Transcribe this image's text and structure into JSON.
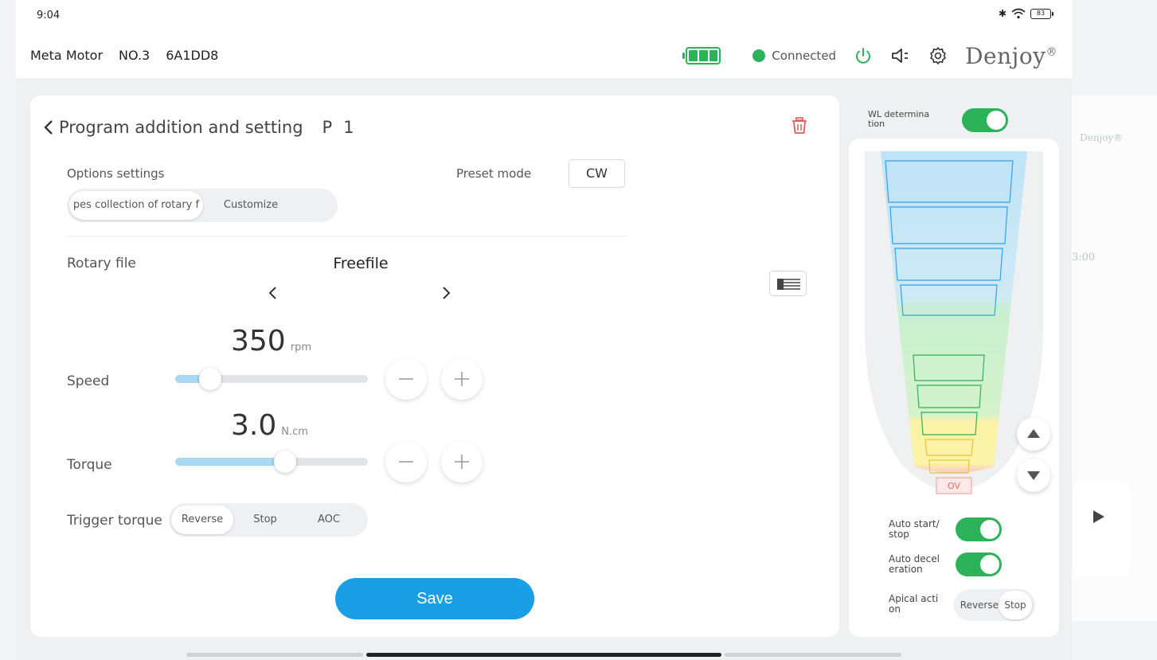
{
  "status_bar": {
    "time": "9:04",
    "battery": "83"
  },
  "app_bar": {
    "device_name": "Meta Motor",
    "device_no": "NO.3",
    "device_id": "6A1DD8",
    "connection_status": "Connected",
    "brand": "Denjoy",
    "brand_mark": "®"
  },
  "program": {
    "title": "Program addition and setting",
    "program_label": "P",
    "program_number": "1",
    "options_label": "Options settings",
    "option_tabs": [
      "pes collection of rotary f",
      "Customize"
    ],
    "preset_label": "Preset mode",
    "preset_value": "CW",
    "rotary_file_label": "Rotary file",
    "rotary_file_value": "Freefile",
    "speed": {
      "label": "Speed",
      "value": "350",
      "unit": "rpm",
      "level": 0.18
    },
    "torque": {
      "label": "Torque",
      "value": "3.0",
      "unit": "N.cm",
      "level": 0.57
    },
    "trigger_label": "Trigger torque",
    "trigger_options": [
      "Reverse",
      "Stop",
      "AOC"
    ],
    "save_label": "Save"
  },
  "right_panel": {
    "wl_label": "WL determina tion",
    "ov_label": "OV",
    "auto_start_label": "Auto start/ stop",
    "auto_decel_label": "Auto decel eration",
    "apical_label": "Apical acti on",
    "apical_options": [
      "Reverse",
      "Stop"
    ]
  },
  "background_app": {
    "brand": "Denjoy®",
    "time_fragment": "3:00"
  },
  "colors": {
    "accent": "#1a9ee6",
    "connected": "#2cb35a",
    "toggle_on": "#2cb35a",
    "slider_fill": "#a9d8f3",
    "delete": "#e05a5a"
  }
}
